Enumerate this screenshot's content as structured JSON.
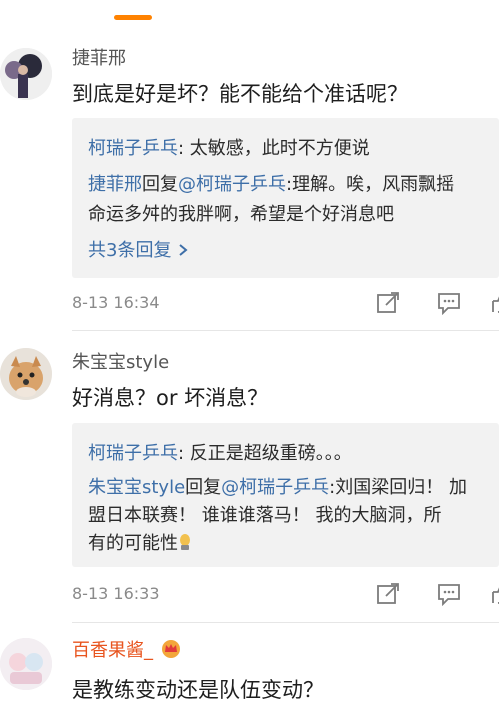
{
  "colors": {
    "accent": "#ff8200",
    "link": "#3e6fa8",
    "reply_bg": "#f2f2f2",
    "meta": "#8a8a8a"
  },
  "comments": [
    {
      "username": "捷菲邢",
      "text": "到底是好是坏？能不能给个准话呢？",
      "replies": [
        {
          "name": "柯瑞子乒乓",
          "sep": ": ",
          "text": "太敏感，此时不方便说"
        },
        {
          "name": "捷菲邢",
          "sep": "回复",
          "mention": "@柯瑞子乒乓",
          "text": ":理解。唉，风雨飘摇",
          "cont": "命运多舛的我胖啊，希望是个好消息吧"
        }
      ],
      "more_replies": "共3条回复",
      "time": "8-13 16:34",
      "icons": [
        "share-icon",
        "comment-icon",
        "like-icon"
      ]
    },
    {
      "username": "朱宝宝style",
      "text": "好消息？or 坏消息？",
      "replies": [
        {
          "name": "柯瑞子乒乓",
          "sep": ": ",
          "text": "反正是超级重磅。。。"
        },
        {
          "name": "朱宝宝style",
          "sep": "回复",
          "mention": "@柯瑞子乒乓",
          "text": ":刘国梁回归！ 加",
          "cont": "盟日本联赛！ 谁谁谁落马！ 我的大脑洞，所",
          "cont2": "有的可能性"
        }
      ],
      "time": "8-13 16:33",
      "icons": [
        "share-icon",
        "comment-icon",
        "like-icon"
      ]
    },
    {
      "username": "百香果酱_",
      "text": "是教练变动还是队伍变动？",
      "badge_icon": "crown-badge-icon"
    }
  ]
}
